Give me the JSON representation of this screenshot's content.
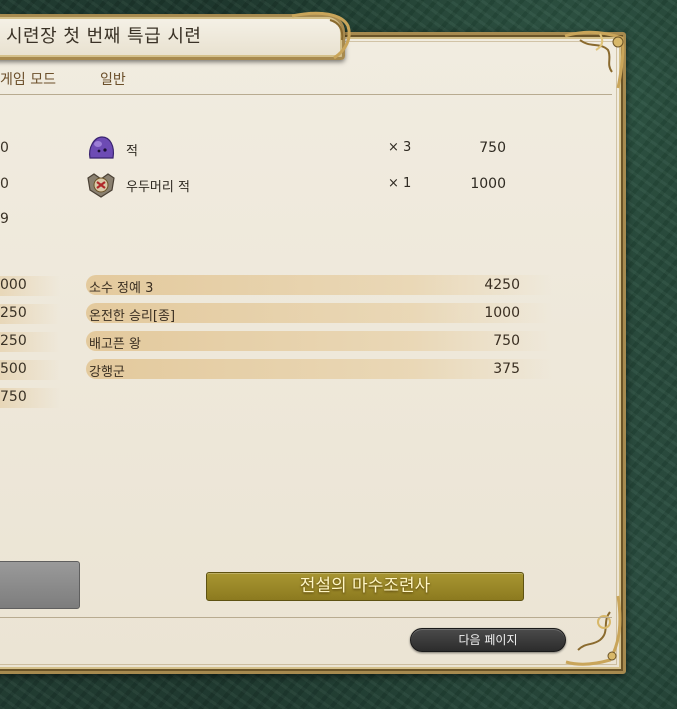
{
  "header": {
    "title": "시련장 첫 번째 특급 시련"
  },
  "mode": {
    "label": "게임 모드",
    "value": "일반"
  },
  "left_column": [
    "0",
    "0",
    "9",
    "000",
    "250",
    "250",
    "500",
    "750"
  ],
  "enemies": [
    {
      "icon": "purple-slime-icon",
      "name": "적",
      "count": "× 3",
      "score": "750"
    },
    {
      "icon": "masked-enemy-icon",
      "name": "우두머리 적",
      "count": "× 1",
      "score": "1000"
    }
  ],
  "bonuses": [
    {
      "name": "소수 정예 3",
      "score": "4250"
    },
    {
      "name": "온전한 승리[종]",
      "score": "1000"
    },
    {
      "name": "배고픈 왕",
      "score": "750"
    },
    {
      "name": "강행군",
      "score": "375"
    }
  ],
  "award": {
    "title": "전설의 마수조련사"
  },
  "navigation": {
    "next_label": "다음 페이지"
  },
  "colors": {
    "panel": "#ebe4d4",
    "frame_gold": "#a78a4f",
    "award_bg": "#a89632",
    "award_text": "#fff6c4"
  }
}
